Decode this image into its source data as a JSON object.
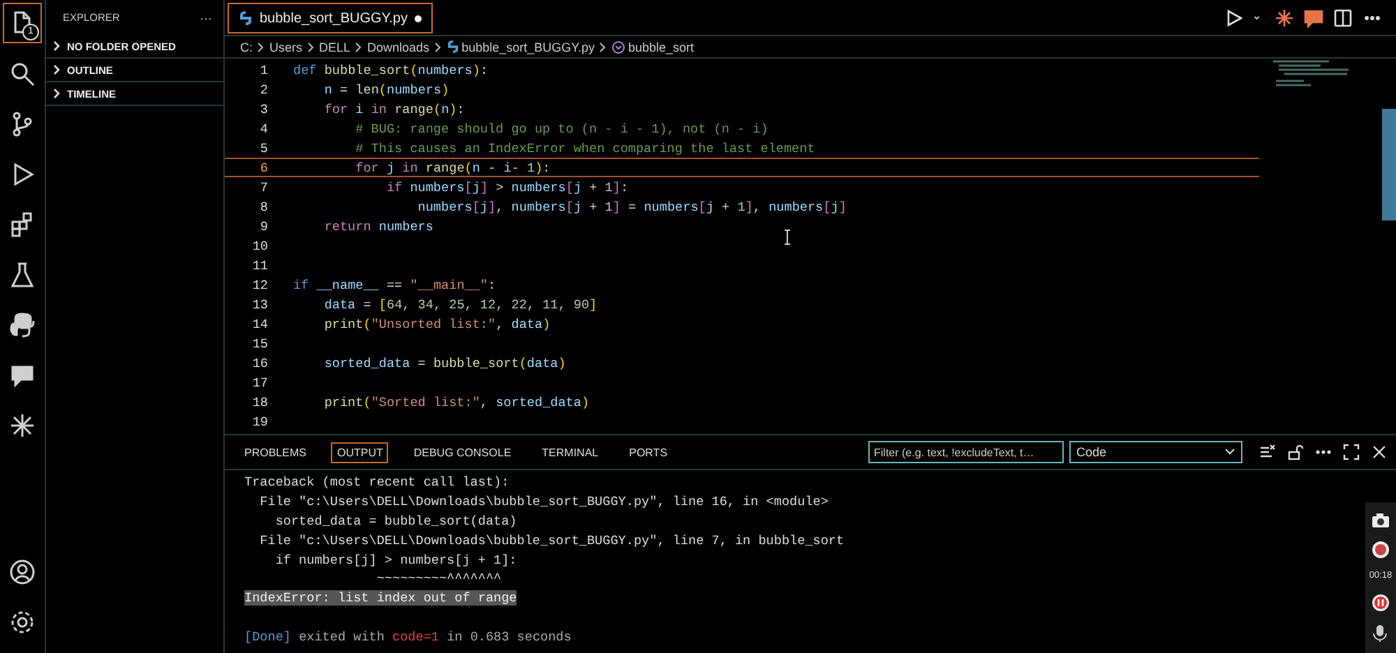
{
  "activity_bar": {
    "items": [
      {
        "kind": "explorer",
        "selected": true,
        "badge": "1"
      },
      {
        "kind": "search",
        "selected": false
      },
      {
        "kind": "source_control",
        "selected": false
      },
      {
        "kind": "run_debug",
        "selected": false
      },
      {
        "kind": "extensions",
        "selected": false
      },
      {
        "kind": "testing",
        "selected": false
      },
      {
        "kind": "python",
        "selected": false
      },
      {
        "kind": "chat",
        "selected": false
      },
      {
        "kind": "sparkle",
        "selected": false
      }
    ],
    "bottom": [
      {
        "kind": "account"
      },
      {
        "kind": "settings"
      }
    ]
  },
  "sidebar": {
    "title": "EXPLORER",
    "more": "···",
    "sections": [
      {
        "label": "NO FOLDER OPENED",
        "expanded": false
      },
      {
        "label": "OUTLINE",
        "expanded": false
      },
      {
        "label": "TIMELINE",
        "expanded": false
      }
    ]
  },
  "tabs": [
    {
      "label": "bubble_sort_BUGGY.py",
      "selected": true,
      "modified": true
    }
  ],
  "editor_actions": [
    {
      "kind": "run"
    },
    {
      "kind": "chevron"
    },
    {
      "kind": "sparkle"
    },
    {
      "kind": "chat"
    },
    {
      "kind": "split"
    },
    {
      "kind": "more"
    }
  ],
  "breadcrumbs": [
    {
      "label": "C:",
      "kind": "folder"
    },
    {
      "label": "Users",
      "kind": "folder"
    },
    {
      "label": "DELL",
      "kind": "folder"
    },
    {
      "label": "Downloads",
      "kind": "folder"
    },
    {
      "label": "bubble_sort_BUGGY.py",
      "kind": "file"
    },
    {
      "label": "bubble_sort",
      "kind": "symbol"
    }
  ],
  "code": [
    {
      "number": "1",
      "current": false,
      "tokens": [
        {
          "text": "def",
          "kind": "d"
        },
        {
          "text": " bubble_sort",
          "kind": "f"
        },
        {
          "text": "(",
          "kind": "p"
        },
        {
          "text": "numbers",
          "kind": "v"
        },
        {
          "text": ")",
          "kind": "p"
        },
        {
          "text": ":",
          "kind": "o"
        }
      ]
    },
    {
      "number": "2",
      "current": false,
      "tokens": [
        {
          "text": "    n",
          "kind": "v"
        },
        {
          "text": " = ",
          "kind": "o"
        },
        {
          "text": "len",
          "kind": "f"
        },
        {
          "text": "(",
          "kind": "p"
        },
        {
          "text": "numbers",
          "kind": "v"
        },
        {
          "text": ")",
          "kind": "p"
        }
      ]
    },
    {
      "number": "3",
      "current": false,
      "tokens": [
        {
          "text": "    for",
          "kind": "k"
        },
        {
          "text": " i ",
          "kind": "v"
        },
        {
          "text": "in",
          "kind": "k"
        },
        {
          "text": " range",
          "kind": "f"
        },
        {
          "text": "(",
          "kind": "p"
        },
        {
          "text": "n",
          "kind": "v"
        },
        {
          "text": ")",
          "kind": "p"
        },
        {
          "text": ":",
          "kind": "o"
        }
      ]
    },
    {
      "number": "4",
      "current": false,
      "tokens": [
        {
          "text": "        # BUG: range should go up to (n - i - 1), not (n - i)",
          "kind": "c"
        }
      ]
    },
    {
      "number": "5",
      "current": false,
      "tokens": [
        {
          "text": "        # This causes an IndexError when comparing the last element",
          "kind": "c"
        }
      ]
    },
    {
      "number": "6",
      "current": true,
      "tokens": [
        {
          "text": "        for",
          "kind": "k"
        },
        {
          "text": " j ",
          "kind": "v"
        },
        {
          "text": "in",
          "kind": "k"
        },
        {
          "text": " range",
          "kind": "f"
        },
        {
          "text": "(",
          "kind": "p"
        },
        {
          "text": "n",
          "kind": "v"
        },
        {
          "text": " - ",
          "kind": "o"
        },
        {
          "text": "i",
          "kind": "v"
        },
        {
          "text": "- ",
          "kind": "o"
        },
        {
          "text": "1",
          "kind": "n"
        },
        {
          "text": ")",
          "kind": "p"
        },
        {
          "text": ":",
          "kind": "o"
        }
      ]
    },
    {
      "number": "7",
      "current": false,
      "tokens": [
        {
          "text": "            if",
          "kind": "k"
        },
        {
          "text": " numbers",
          "kind": "v"
        },
        {
          "text": "[",
          "kind": "b"
        },
        {
          "text": "j",
          "kind": "v"
        },
        {
          "text": "]",
          "kind": "b"
        },
        {
          "text": " > ",
          "kind": "o"
        },
        {
          "text": "numbers",
          "kind": "v"
        },
        {
          "text": "[",
          "kind": "b"
        },
        {
          "text": "j",
          "kind": "v"
        },
        {
          "text": " + ",
          "kind": "o"
        },
        {
          "text": "1",
          "kind": "n"
        },
        {
          "text": "]",
          "kind": "b"
        },
        {
          "text": ":",
          "kind": "o"
        }
      ]
    },
    {
      "number": "8",
      "current": false,
      "tokens": [
        {
          "text": "                numbers",
          "kind": "v"
        },
        {
          "text": "[",
          "kind": "b"
        },
        {
          "text": "j",
          "kind": "v"
        },
        {
          "text": "]",
          "kind": "b"
        },
        {
          "text": ", ",
          "kind": "o"
        },
        {
          "text": "numbers",
          "kind": "v"
        },
        {
          "text": "[",
          "kind": "b"
        },
        {
          "text": "j",
          "kind": "v"
        },
        {
          "text": " + ",
          "kind": "o"
        },
        {
          "text": "1",
          "kind": "n"
        },
        {
          "text": "]",
          "kind": "b"
        },
        {
          "text": " = ",
          "kind": "o"
        },
        {
          "text": "numbers",
          "kind": "v"
        },
        {
          "text": "[",
          "kind": "b"
        },
        {
          "text": "j",
          "kind": "v"
        },
        {
          "text": " + ",
          "kind": "o"
        },
        {
          "text": "1",
          "kind": "n"
        },
        {
          "text": "]",
          "kind": "b"
        },
        {
          "text": ", ",
          "kind": "o"
        },
        {
          "text": "numbers",
          "kind": "v"
        },
        {
          "text": "[",
          "kind": "b"
        },
        {
          "text": "j",
          "kind": "v"
        },
        {
          "text": "]",
          "kind": "b"
        }
      ]
    },
    {
      "number": "9",
      "current": false,
      "tokens": [
        {
          "text": "    return",
          "kind": "k"
        },
        {
          "text": " numbers",
          "kind": "v"
        }
      ]
    },
    {
      "number": "10",
      "current": false
    },
    {
      "number": "11",
      "current": false
    },
    {
      "number": "12",
      "current": false,
      "tokens": [
        {
          "text": "if",
          "kind": "d"
        },
        {
          "text": " __name__ ",
          "kind": "v"
        },
        {
          "text": "==",
          "kind": "o"
        },
        {
          "text": " \"__main__\"",
          "kind": "s"
        },
        {
          "text": ":",
          "kind": "o"
        }
      ]
    },
    {
      "number": "13",
      "current": false,
      "tokens": [
        {
          "text": "    data",
          "kind": "v"
        },
        {
          "text": " = ",
          "kind": "o"
        },
        {
          "text": "[",
          "kind": "p"
        },
        {
          "text": "64, 34, 25, 12, 22, 11, 90",
          "kind": "n"
        },
        {
          "text": "]",
          "kind": "p"
        }
      ]
    },
    {
      "number": "14",
      "current": false,
      "tokens": [
        {
          "text": "    print",
          "kind": "f"
        },
        {
          "text": "(",
          "kind": "p"
        },
        {
          "text": "\"Unsorted list:\"",
          "kind": "s"
        },
        {
          "text": ", ",
          "kind": "o"
        },
        {
          "text": "data",
          "kind": "v"
        },
        {
          "text": ")",
          "kind": "p"
        }
      ]
    },
    {
      "number": "15",
      "current": false
    },
    {
      "number": "16",
      "current": false,
      "tokens": [
        {
          "text": "    sorted_data",
          "kind": "v"
        },
        {
          "text": " = ",
          "kind": "o"
        },
        {
          "text": "bubble_sort",
          "kind": "f"
        },
        {
          "text": "(",
          "kind": "p"
        },
        {
          "text": "data",
          "kind": "v"
        },
        {
          "text": ")",
          "kind": "p"
        }
      ]
    },
    {
      "number": "17",
      "current": false
    },
    {
      "number": "18",
      "current": false,
      "tokens": [
        {
          "text": "    print",
          "kind": "f"
        },
        {
          "text": "(",
          "kind": "p"
        },
        {
          "text": "\"Sorted list:\"",
          "kind": "s"
        },
        {
          "text": ", ",
          "kind": "o"
        },
        {
          "text": "sorted_data",
          "kind": "v"
        },
        {
          "text": ")",
          "kind": "p"
        }
      ]
    },
    {
      "number": "19",
      "current": false
    }
  ],
  "panel": {
    "tabs": [
      {
        "label": "PROBLEMS",
        "selected": false
      },
      {
        "label": "OUTPUT",
        "selected": true
      },
      {
        "label": "DEBUG CONSOLE",
        "selected": false
      },
      {
        "label": "TERMINAL",
        "selected": false
      },
      {
        "label": "PORTS",
        "selected": false
      }
    ],
    "filter": {
      "placeholder": "Filter (e.g. text, !excludeText, t…"
    },
    "channel": "Code",
    "actions": [
      {
        "kind": "clear"
      },
      {
        "kind": "lock"
      },
      {
        "kind": "more"
      },
      {
        "kind": "maximize"
      },
      {
        "kind": "close"
      }
    ],
    "output": [
      {
        "kind": "line",
        "segments": [
          {
            "text": "Traceback (most recent call last):",
            "kind": "o"
          }
        ]
      },
      {
        "kind": "line",
        "segments": [
          {
            "text": "  File \"c:\\Users\\DELL\\Downloads\\bubble_sort_BUGGY.py\", line 16, in <module>",
            "kind": "o"
          }
        ]
      },
      {
        "kind": "line",
        "segments": [
          {
            "text": "    sorted_data = bubble_sort(data)",
            "kind": "o"
          }
        ]
      },
      {
        "kind": "line",
        "segments": [
          {
            "text": "  File \"c:\\Users\\DELL\\Downloads\\bubble_sort_BUGGY.py\", line 7, in bubble_sort",
            "kind": "o"
          }
        ]
      },
      {
        "kind": "line",
        "segments": [
          {
            "text": "    if numbers[j] > numbers[j + 1]:",
            "kind": "o"
          }
        ]
      },
      {
        "kind": "line",
        "segments": [
          {
            "text": "                 ~~~~~~~~~^^^^^^^",
            "kind": "o"
          }
        ]
      },
      {
        "kind": "line",
        "segments": [
          {
            "text": "IndexError: list index out of range",
            "kind": "sel"
          }
        ]
      },
      {
        "kind": "status",
        "segments": [
          {
            "text": "[Done]",
            "kind": "done"
          },
          {
            "text": " exited with ",
            "kind": "dim"
          },
          {
            "text": "code=1",
            "kind": "err"
          },
          {
            "text": " in 0.683 seconds",
            "kind": "dim"
          }
        ]
      }
    ]
  },
  "recorder": {
    "timer": "00:18"
  }
}
